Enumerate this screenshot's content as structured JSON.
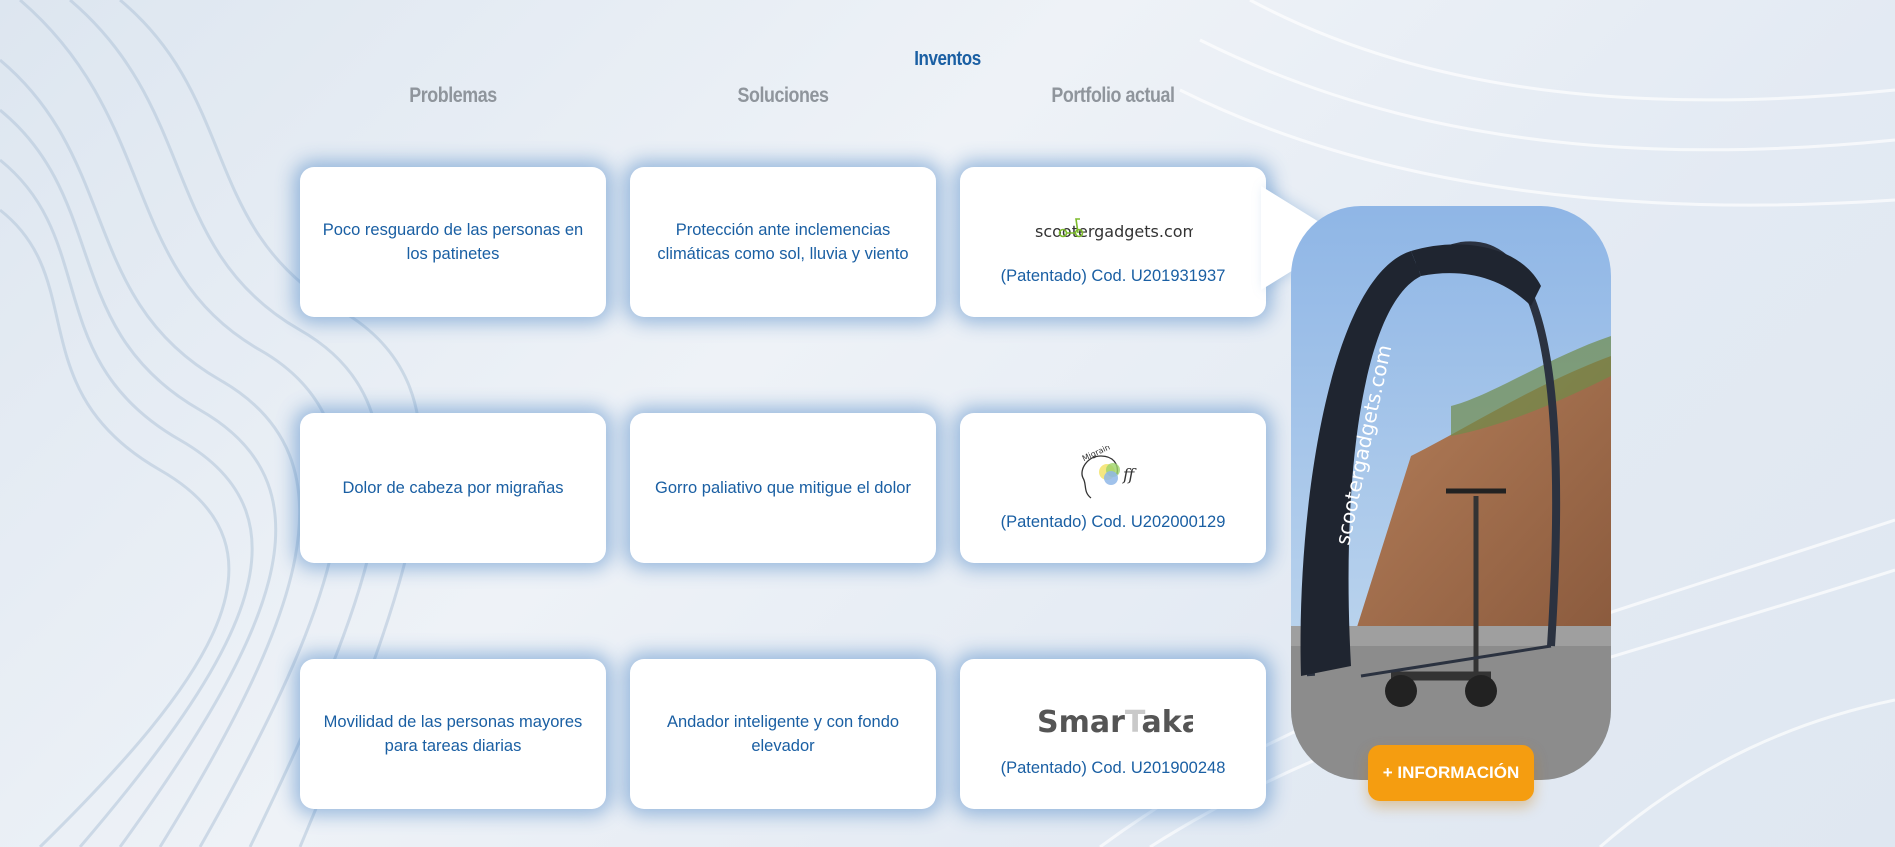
{
  "page": {
    "title": "Inventos",
    "columns": {
      "problems": "Problemas",
      "solutions": "Soluciones",
      "portfolio": "Portfolio actual"
    }
  },
  "rows": [
    {
      "problem": "Poco resguardo de las personas en los patinetes",
      "solution": "Protección ante inclemencias climáticas como sol, lluvia y viento",
      "logo": "scootergadgets.com",
      "code": "(Patentado) Cod. U201931937"
    },
    {
      "problem": "Dolor de cabeza por migrañas",
      "solution": "Gorro paliativo que mitigue el dolor",
      "logo": "Migrain ff",
      "code": "(Patentado) Cod. U202000129"
    },
    {
      "problem": "Movilidad de las personas mayores para tareas diarias",
      "solution": "Andador inteligente y con fondo elevador",
      "logo": "SmarTaka",
      "code": "(Patentado) Cod. U201900248"
    }
  ],
  "showcase": {
    "banner_text": "scootergadgets.com",
    "button_label": "+ INFORMACIÓN"
  },
  "colors": {
    "text_blue": "#1a5fa3",
    "header_gray": "#8f959c",
    "button_orange": "#f59d10"
  }
}
